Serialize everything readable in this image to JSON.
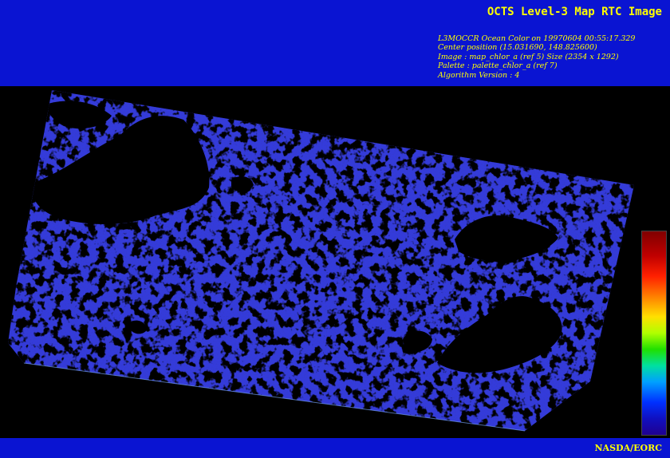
{
  "header": {
    "title": "OCTS Level-3 Map RTC Image",
    "info_lines": [
      "L3MOCCR Ocean Color on 19970604 00:55:17.329",
      "Center position (15.031690, 148.825600)",
      "Image : map_chlor_a (ref 5) Size (2354 x 1292)",
      "Palette : palette_chlor_a (ref 7)",
      "Algorithm Version : 4"
    ]
  },
  "footer": {
    "credit": "NASDA/EORC"
  },
  "colors": {
    "banner": "#0a14d2",
    "text": "#ffff00",
    "background": "#000000",
    "ocean": "#1b20c0"
  }
}
